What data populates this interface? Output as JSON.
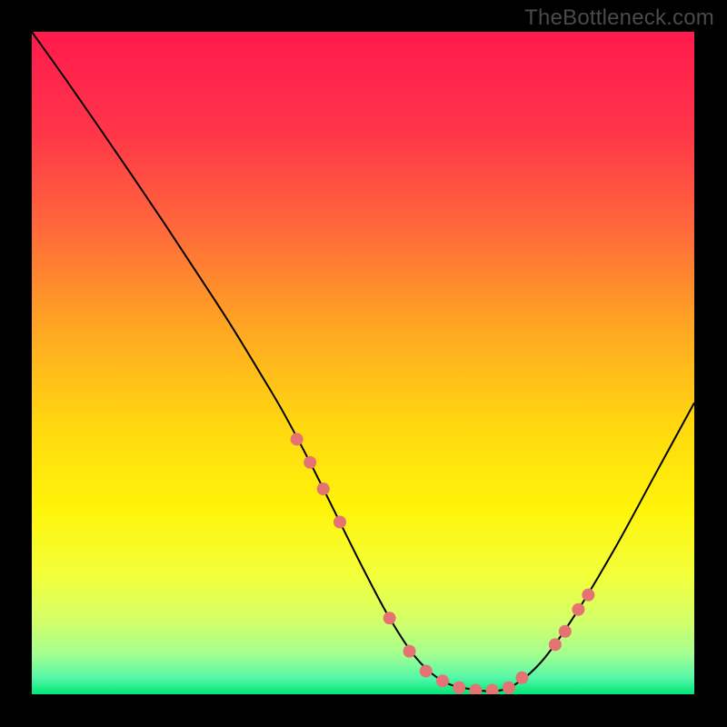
{
  "watermark": "TheBottleneck.com",
  "chart_data": {
    "type": "line",
    "title": "",
    "xlabel": "",
    "ylabel": "",
    "xlim": [
      0,
      100
    ],
    "ylim": [
      0,
      100
    ],
    "background": {
      "type": "vertical-gradient",
      "stops": [
        {
          "offset": 0.0,
          "color": "#ff1a4d"
        },
        {
          "offset": 0.15,
          "color": "#ff3549"
        },
        {
          "offset": 0.3,
          "color": "#ff6a3a"
        },
        {
          "offset": 0.45,
          "color": "#ffa822"
        },
        {
          "offset": 0.6,
          "color": "#ffd90f"
        },
        {
          "offset": 0.72,
          "color": "#fff40a"
        },
        {
          "offset": 0.82,
          "color": "#f3ff3a"
        },
        {
          "offset": 0.89,
          "color": "#d3ff6a"
        },
        {
          "offset": 0.94,
          "color": "#a3ff90"
        },
        {
          "offset": 0.975,
          "color": "#55f7a8"
        },
        {
          "offset": 1.0,
          "color": "#00e676"
        }
      ]
    },
    "series": [
      {
        "name": "bottleneck-curve",
        "color": "#000000",
        "width": 2,
        "x": [
          0.0,
          5.0,
          10.0,
          15.0,
          20.0,
          25.0,
          30.0,
          35.0,
          38.0,
          42.0,
          46.0,
          50.0,
          54.0,
          58.0,
          62.0,
          66.0,
          70.0,
          73.0,
          77.0,
          82.0,
          88.0,
          94.0,
          100.0
        ],
        "y": [
          100.0,
          93.0,
          85.8,
          78.5,
          71.1,
          63.5,
          55.8,
          47.6,
          42.5,
          35.0,
          27.0,
          19.0,
          11.5,
          5.5,
          2.0,
          0.8,
          0.5,
          1.5,
          5.0,
          12.0,
          22.0,
          33.0,
          44.0
        ]
      }
    ],
    "markers": {
      "name": "highlight-points",
      "color": "#e57373",
      "radius": 7,
      "points": [
        {
          "x": 40.0,
          "y": 38.5
        },
        {
          "x": 42.0,
          "y": 35.0
        },
        {
          "x": 44.0,
          "y": 31.0
        },
        {
          "x": 46.5,
          "y": 26.0
        },
        {
          "x": 54.0,
          "y": 11.5
        },
        {
          "x": 57.0,
          "y": 6.5
        },
        {
          "x": 59.5,
          "y": 3.5
        },
        {
          "x": 62.0,
          "y": 2.0
        },
        {
          "x": 64.5,
          "y": 1.0
        },
        {
          "x": 67.0,
          "y": 0.6
        },
        {
          "x": 69.5,
          "y": 0.6
        },
        {
          "x": 72.0,
          "y": 1.0
        },
        {
          "x": 74.0,
          "y": 2.5
        },
        {
          "x": 79.0,
          "y": 7.5
        },
        {
          "x": 80.5,
          "y": 9.5
        },
        {
          "x": 82.5,
          "y": 12.8
        },
        {
          "x": 84.0,
          "y": 15.0
        }
      ]
    }
  }
}
